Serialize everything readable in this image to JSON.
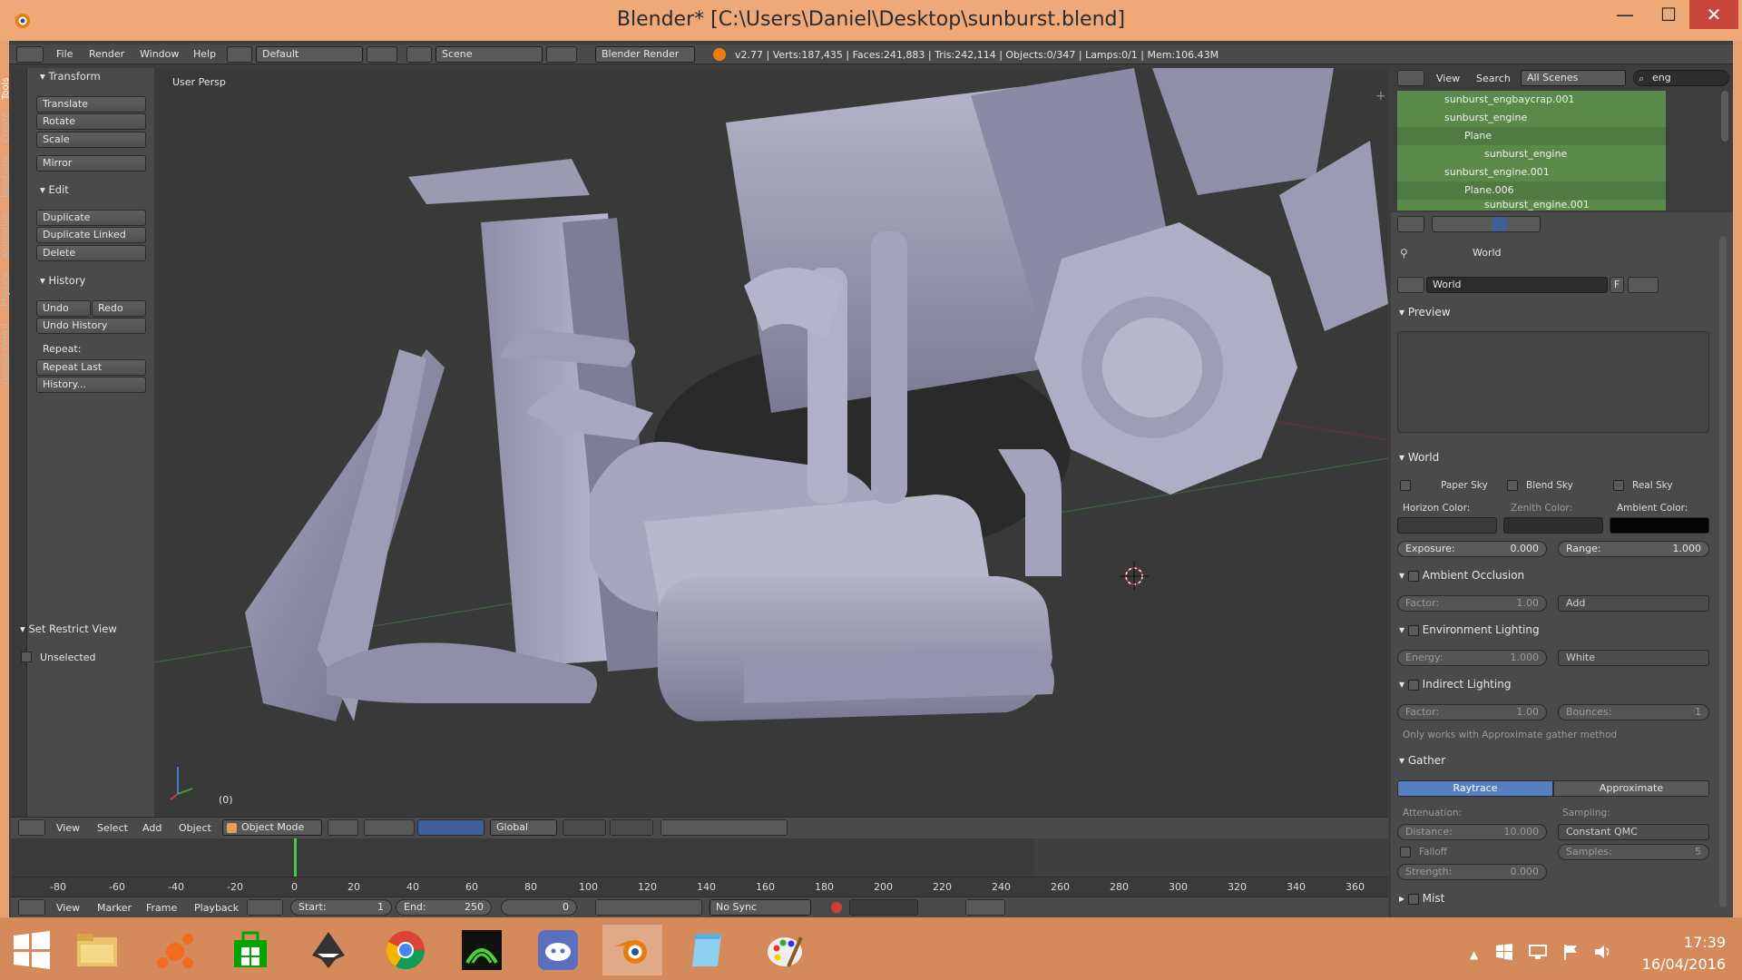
{
  "window": {
    "title": "Blender* [C:\\Users\\Daniel\\Desktop\\sunburst.blend]",
    "minimize": "—",
    "maximize": "☐",
    "close": "✕"
  },
  "info_header": {
    "menus": [
      "File",
      "Render",
      "Window",
      "Help"
    ],
    "layout": "Default",
    "scene": "Scene",
    "engine": "Blender Render",
    "stats": "v2.77 | Verts:187,435 | Faces:241,883 | Tris:242,114 | Objects:0/347 | Lamps:0/1 | Mem:106.43M"
  },
  "tool_tabs": [
    "Tools",
    "Create",
    "Relations",
    "Animation",
    "Physics",
    "Grease Pencil"
  ],
  "tool_shelf": {
    "transform_header": "Transform",
    "translate": "Translate",
    "rotate": "Rotate",
    "scale": "Scale",
    "mirror": "Mirror",
    "edit_header": "Edit",
    "duplicate": "Duplicate",
    "duplicate_linked": "Duplicate Linked",
    "delete": "Delete",
    "history_header": "History",
    "undo": "Undo",
    "redo": "Redo",
    "undo_history": "Undo History",
    "repeat_label": "Repeat:",
    "repeat_last": "Repeat Last",
    "history": "History...",
    "restrict_header": "Set Restrict View",
    "unselected": "Unselected"
  },
  "viewport": {
    "label": "User Persp",
    "frame_label": "(0)"
  },
  "view3d_header": {
    "view": "View",
    "select": "Select",
    "add": "Add",
    "object": "Object",
    "mode": "Object Mode",
    "orientation": "Global"
  },
  "timeline": {
    "ruler": [
      "-80",
      "-60",
      "-40",
      "-20",
      "0",
      "20",
      "40",
      "60",
      "80",
      "100",
      "120",
      "140",
      "160",
      "180",
      "200",
      "220",
      "240",
      "260",
      "280",
      "300",
      "320",
      "340",
      "360"
    ],
    "view": "View",
    "marker": "Marker",
    "frame": "Frame",
    "playback": "Playback",
    "start_label": "Start:",
    "start": "1",
    "end_label": "End:",
    "end": "250",
    "current": "0",
    "sync": "No Sync"
  },
  "outliner": {
    "view": "View",
    "search": "Search",
    "scenes": "All Scenes",
    "filter": "eng",
    "rows": [
      {
        "label": "sunburst_engbaycrap.001",
        "indent": 0
      },
      {
        "label": "sunburst_engine",
        "indent": 0
      },
      {
        "label": "Plane",
        "indent": 1
      },
      {
        "label": "sunburst_engine",
        "indent": 2
      },
      {
        "label": "sunburst_engine.001",
        "indent": 0
      },
      {
        "label": "Plane.006",
        "indent": 1
      },
      {
        "label": "sunburst_engine.001",
        "indent": 2
      }
    ]
  },
  "properties": {
    "breadcrumb": "World",
    "world_name": "World",
    "world_fake": "F",
    "preview_header": "Preview",
    "world_header": "World",
    "paper_sky": "Paper Sky",
    "blend_sky": "Blend Sky",
    "real_sky": "Real Sky",
    "horizon_color": "Horizon Color:",
    "zenith_color": "Zenith Color:",
    "ambient_color": "Ambient Color:",
    "exposure_label": "Exposure:",
    "exposure": "0.000",
    "range_label": "Range:",
    "range": "1.000",
    "ao_header": "Ambient Occlusion",
    "ao_factor_label": "Factor:",
    "ao_factor": "1.00",
    "ao_blend": "Add",
    "env_header": "Environment Lighting",
    "energy_label": "Energy:",
    "energy": "1.000",
    "env_color": "White",
    "indirect_header": "Indirect Lighting",
    "ind_factor_label": "Factor:",
    "ind_factor": "1.00",
    "bounces_label": "Bounces:",
    "bounces": "1",
    "indirect_note": "Only works with Approximate gather method",
    "gather_header": "Gather",
    "raytrace": "Raytrace",
    "approximate": "Approximate",
    "attenuation_label": "Attenuation:",
    "sampling_label": "Sampling:",
    "distance_label": "Distance:",
    "distance": "10.000",
    "sampling_method": "Constant QMC",
    "falloff": "Falloff",
    "samples_label": "Samples:",
    "samples": "5",
    "strength_label": "Strength:",
    "strength": "0.000",
    "mist_header": "Mist"
  },
  "taskbar": {
    "time": "17:39",
    "date": "16/04/2016"
  },
  "colors": {
    "title_bar": "#efa877",
    "taskbar": "#d48a5a",
    "outliner_highlight": "#5a8a4a",
    "gather_active": "#5680c2"
  }
}
